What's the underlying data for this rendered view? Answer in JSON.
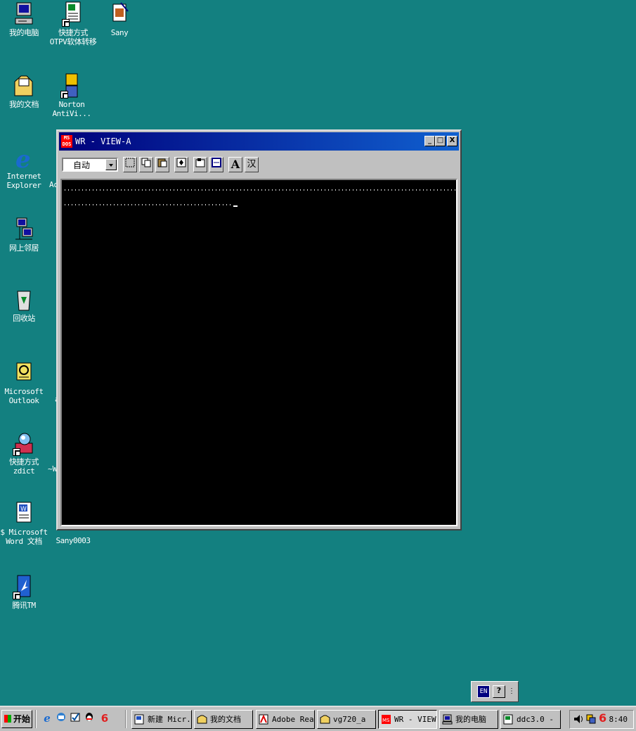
{
  "desktop": {
    "background": "#138080",
    "icons": [
      {
        "label": "我的电脑"
      },
      {
        "label": "快捷方式\nOTPV软体转移"
      },
      {
        "label": "Sany"
      },
      {
        "label": "我的文档"
      },
      {
        "label": "Norton\nAntiVi..."
      },
      {
        "label": "Internet\nExplorer"
      },
      {
        "label": "网上邻居"
      },
      {
        "label": "回收站"
      },
      {
        "label": "Microsoft\nOutlook"
      },
      {
        "label": "快捷方式\nzdict"
      },
      {
        "label": "$ Microsoft\nWord 文档"
      },
      {
        "label": "Sany0003"
      },
      {
        "label": "腾讯TM"
      }
    ],
    "partial_labels": [
      "Ad",
      "a",
      "~W"
    ]
  },
  "window": {
    "title": "WR - VIEW-A",
    "app_icon_text": "MS DOS",
    "buttons": {
      "minimize": "_",
      "maximize": "□",
      "close": "X"
    },
    "toolbar": {
      "font_size_select": "自动",
      "tools": [
        "mark-icon",
        "copy-icon",
        "paste-icon",
        "fullscreen-icon",
        "properties-icon",
        "background-icon",
        "font-icon",
        "chinese-input-icon"
      ],
      "font_label": "A",
      "chinese_label": "汉"
    }
  },
  "langbar": {
    "lang": "EN",
    "help": "?",
    "more": "⋮"
  },
  "taskbar": {
    "start_label": "开始",
    "tasks": [
      {
        "label": "新建 Micr..."
      },
      {
        "label": "我的文档"
      },
      {
        "label": "Adobe Rea..."
      },
      {
        "label": "vg720_a"
      },
      {
        "label": "WR - VIEW-A",
        "active": true
      },
      {
        "label": "我的电脑"
      },
      {
        "label": "ddc3.0 - ..."
      }
    ],
    "clock": "8:40"
  }
}
